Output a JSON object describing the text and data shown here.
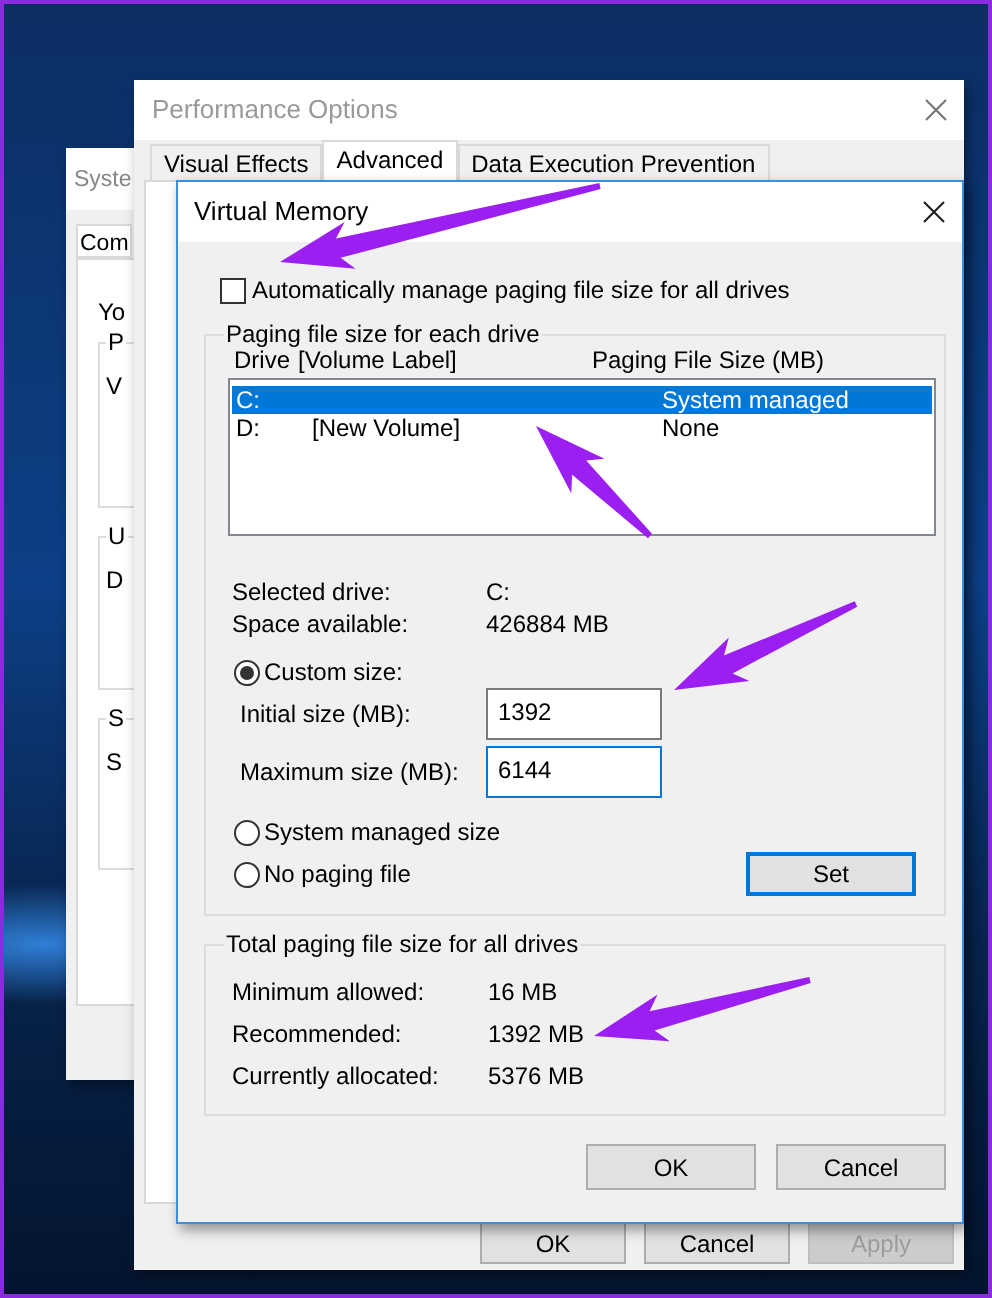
{
  "background_window": {
    "title": "Syste",
    "tab": "Com",
    "intro": "Yo",
    "groups": [
      {
        "label": "P",
        "text": "V"
      },
      {
        "label": "U",
        "text": "D"
      },
      {
        "label": "S",
        "text": "S"
      }
    ]
  },
  "performance_options": {
    "title": "Performance Options",
    "tabs": [
      {
        "label": "Visual Effects",
        "selected": false
      },
      {
        "label": "Advanced",
        "selected": true
      },
      {
        "label": "Data Execution Prevention",
        "selected": false
      }
    ],
    "buttons": [
      {
        "label": "OK",
        "disabled": false
      },
      {
        "label": "Cancel",
        "disabled": false
      },
      {
        "label": "Apply",
        "disabled": true
      }
    ]
  },
  "virtual_memory": {
    "title": "Virtual Memory",
    "auto_manage": {
      "label": "Automatically manage paging file size for all drives",
      "checked": false
    },
    "drive_group": {
      "title": "Paging file size for each drive",
      "columns": [
        "Drive",
        "[Volume Label]",
        "Paging File Size (MB)"
      ],
      "drives": [
        {
          "drive": "C:",
          "size": "System managed",
          "selected": true
        },
        {
          "drive": "D:",
          "volume_label": "[New Volume]",
          "size": "None",
          "selected": false
        }
      ],
      "info": [
        {
          "label": "Selected drive:",
          "value": "C:"
        },
        {
          "label": "Space available:",
          "value": "426884 MB"
        }
      ],
      "size_options": [
        {
          "label": "Custom size:",
          "selected": true
        },
        {
          "label": "System managed size",
          "selected": false
        },
        {
          "label": "No paging file",
          "selected": false
        }
      ],
      "fields": [
        {
          "label": "Initial size (MB):",
          "value": "1392"
        },
        {
          "label": "Maximum size (MB):",
          "value": "6144"
        }
      ],
      "set_button": "Set"
    },
    "totals_group": {
      "title": "Total paging file size for all drives",
      "rows": [
        {
          "label": "Minimum allowed:",
          "value": "16 MB"
        },
        {
          "label": "Recommended:",
          "value": "1392 MB"
        },
        {
          "label": "Currently allocated:",
          "value": "5376 MB"
        }
      ]
    },
    "buttons": [
      {
        "label": "OK"
      },
      {
        "label": "Cancel"
      }
    ]
  }
}
